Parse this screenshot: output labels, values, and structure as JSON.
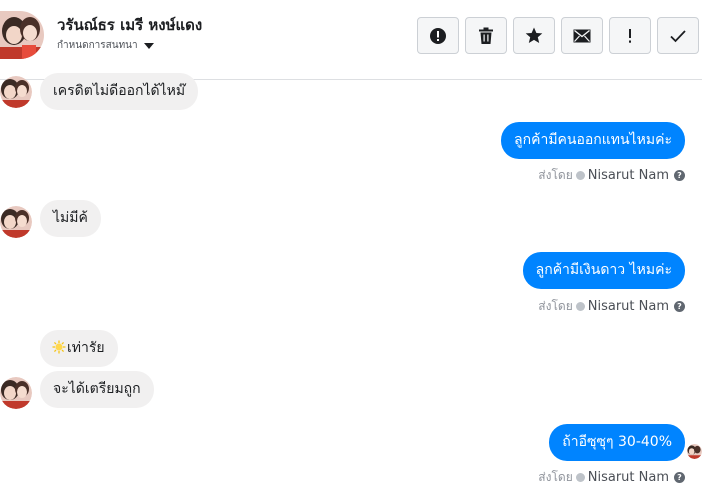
{
  "header": {
    "contact_name": "วรันณ์ธร เมรี หงษ์แดง",
    "subtitle": "กำหนดการสนทนา"
  },
  "toolbar": [
    {
      "name": "alert-circle-button",
      "icon": "exclamation-circle-icon"
    },
    {
      "name": "delete-button",
      "icon": "trash-icon"
    },
    {
      "name": "star-button",
      "icon": "star-icon"
    },
    {
      "name": "mail-button",
      "icon": "envelope-icon"
    },
    {
      "name": "important-button",
      "icon": "exclamation-icon"
    },
    {
      "name": "done-button",
      "icon": "checkmark-icon"
    }
  ],
  "messages": [
    {
      "side": "in",
      "text": "เครดิตไม่ดีออกได้ไหม๊"
    },
    {
      "side": "out",
      "text": "ลูกค้ามีคนออกแทนไหมค่ะ",
      "sent_by_label": "ส่งโดย",
      "sender": "Nisarut Nam"
    },
    {
      "side": "in",
      "text": "ไม่มีค้"
    },
    {
      "side": "out",
      "text": "ลูกค้ามีเงินดาว ไหมค่ะ",
      "sent_by_label": "ส่งโดย",
      "sender": "Nisarut Nam"
    },
    {
      "side": "in",
      "text": "เท่ารัย",
      "emoji": "sun-emoji-icon"
    },
    {
      "side": "in",
      "text": "จะได้เตรียมถูก"
    },
    {
      "side": "out",
      "text": "ถ้าอีซุซุๆ 30-40%",
      "sent_by_label": "ส่งโดย",
      "sender": "Nisarut Nam"
    }
  ],
  "help_glyph": "?",
  "colors": {
    "outgoing_bubble": "#0084ff",
    "incoming_bubble": "#f1f0f0",
    "meta_text": "#90949c"
  }
}
